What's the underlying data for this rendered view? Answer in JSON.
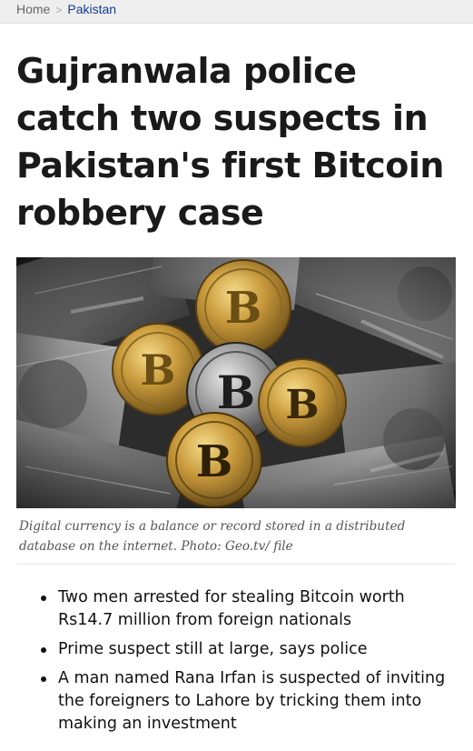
{
  "breadcrumb": {
    "home": "Home",
    "separator": ">",
    "category": "Pakistan"
  },
  "headline": "Gujranwala police catch two suspects in Pakistan's first Bitcoin robbery case",
  "hero": {
    "coin_glyph": "B"
  },
  "caption": "Digital currency is a balance or record stored in a distributed database on the internet. Photo: Geo.tv/ file",
  "bullets": [
    "Two men arrested for stealing Bitcoin worth Rs14.7 million from foreign nationals",
    "Prime suspect still at large, says police",
    "A man named Rana Irfan is suspected of inviting the foreigners to Lahore by tricking them into making an investment"
  ]
}
